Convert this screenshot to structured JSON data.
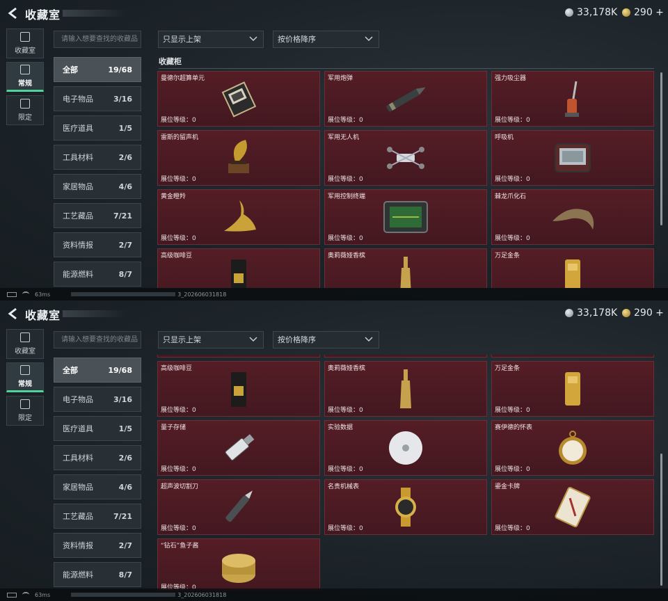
{
  "header": {
    "title": "收藏室",
    "silver": "33,178K",
    "gold": "290 +"
  },
  "rail": [
    {
      "label": "收藏室",
      "icon": "vault-icon",
      "active": false
    },
    {
      "label": "常规",
      "icon": "image-icon",
      "active": true
    },
    {
      "label": "限定",
      "icon": "limited-icon",
      "active": false
    }
  ],
  "search": {
    "placeholder": "请输入想要查找的收藏品"
  },
  "filters": {
    "shelf": "只显示上架",
    "sort": "按价格降序"
  },
  "categories": [
    {
      "label": "全部",
      "count": "19/68"
    },
    {
      "label": "电子物品",
      "count": "3/16"
    },
    {
      "label": "医疗道具",
      "count": "1/5"
    },
    {
      "label": "工具材料",
      "count": "2/6"
    },
    {
      "label": "家居物品",
      "count": "4/6"
    },
    {
      "label": "工艺藏品",
      "count": "7/21"
    },
    {
      "label": "资料情报",
      "count": "2/7"
    },
    {
      "label": "能源燃料",
      "count": "8/7"
    }
  ],
  "section_label": "收藏柜",
  "level_label": "展位等级：",
  "items": [
    {
      "name": "曼德尔超算单元",
      "level": "0",
      "icon": "supercomputer-icon"
    },
    {
      "name": "军用炮弹",
      "level": "0",
      "icon": "shell-icon"
    },
    {
      "name": "强力吸尘器",
      "level": "0",
      "icon": "vacuum-icon"
    },
    {
      "name": "雷斯的留声机",
      "level": "0",
      "icon": "gramophone-icon"
    },
    {
      "name": "军用无人机",
      "level": "0",
      "icon": "drone-icon"
    },
    {
      "name": "呼吸机",
      "level": "0",
      "icon": "ventilator-icon"
    },
    {
      "name": "黄金瞪羚",
      "level": "0",
      "icon": "gazelle-icon"
    },
    {
      "name": "军用控制终端",
      "level": "0",
      "icon": "terminal-icon"
    },
    {
      "name": "棘龙爪化石",
      "level": "0",
      "icon": "claw-icon"
    },
    {
      "name": "高级咖啡豆",
      "level": "0",
      "icon": "coffee-icon"
    },
    {
      "name": "奥莉薇娅香槟",
      "level": "0",
      "icon": "champagne-icon"
    },
    {
      "name": "万足金条",
      "level": "0",
      "icon": "gold-bar-icon"
    },
    {
      "name": "量子存储",
      "level": "0",
      "icon": "usb-icon"
    },
    {
      "name": "实验数据",
      "level": "0",
      "icon": "disc-icon"
    },
    {
      "name": "赛伊德的怀表",
      "level": "0",
      "icon": "watch-icon"
    },
    {
      "name": "超声波切割刀",
      "level": "0",
      "icon": "cutter-icon"
    },
    {
      "name": "名贵机械表",
      "level": "0",
      "icon": "wristwatch-icon"
    },
    {
      "name": "鎏金卡牌",
      "level": "0",
      "icon": "card-icon"
    },
    {
      "name": "“钻石”鱼子酱",
      "level": "0",
      "icon": "caviar-icon"
    }
  ],
  "status": {
    "ping": "63ms",
    "build": "3_202606031818"
  }
}
